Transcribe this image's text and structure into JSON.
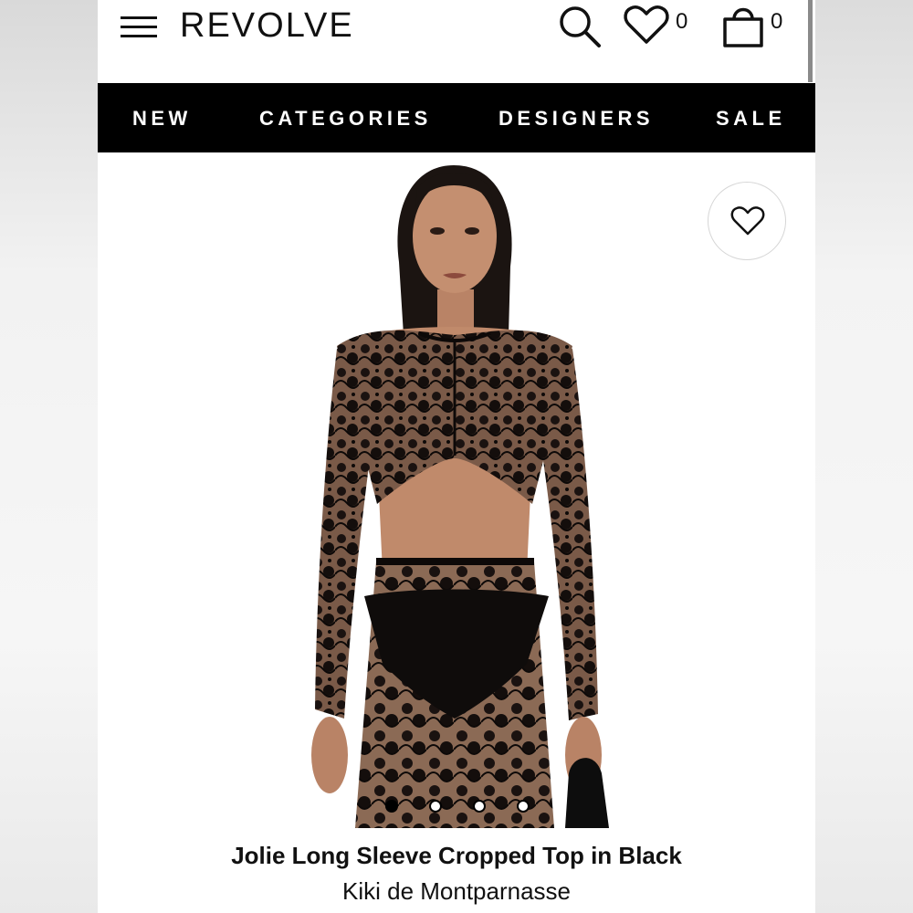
{
  "header": {
    "logo": "REVOLVE",
    "wishlist_count": "0",
    "bag_count": "0",
    "icons": [
      "menu-icon",
      "search-icon",
      "heart-icon",
      "bag-icon"
    ]
  },
  "nav": {
    "items": [
      "NEW",
      "CATEGORIES",
      "DESIGNERS",
      "SALE"
    ]
  },
  "product": {
    "name": "Jolie Long Sleeve Cropped Top in Black",
    "brand": "Kiki de Montparnasse",
    "image_count": 4,
    "active_image": 1
  },
  "colors": {
    "nav_background": "#000000",
    "text": "#111111",
    "page_background": "#ffffff"
  }
}
